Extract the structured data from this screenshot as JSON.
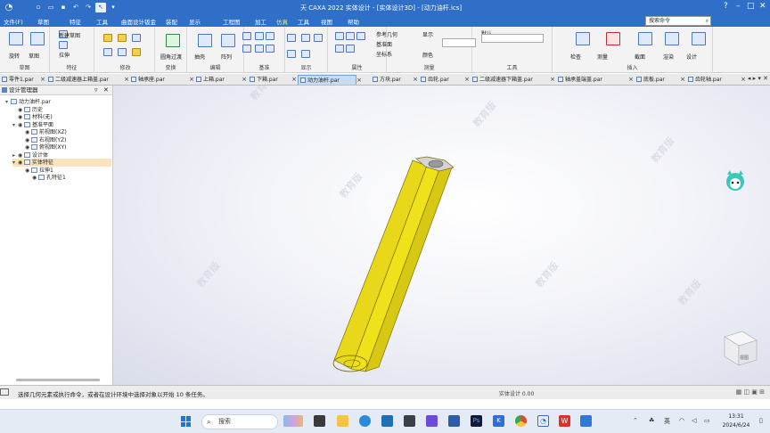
{
  "window": {
    "title": "天 CAXA 2022 实体设计 - [实体设计3D] - [动力油杆.ics]",
    "quick_access": [
      "new",
      "open",
      "save",
      "undo",
      "redo",
      "select"
    ]
  },
  "menu": {
    "items": [
      "文件(F)",
      "草图",
      "特征",
      "工具",
      "曲面设计",
      "钣金",
      "装配",
      "显示",
      "工程图",
      "加工",
      "仿真",
      "工具",
      "视图",
      "帮助"
    ],
    "active_index": 10,
    "search_placeholder": "搜索命令"
  },
  "ribbon": {
    "groups": [
      {
        "label": "草图"
      },
      {
        "label": "特征"
      },
      {
        "label": "修改"
      },
      {
        "label": "变换"
      },
      {
        "label": "编辑"
      },
      {
        "label": "基准"
      },
      {
        "label": "显示"
      },
      {
        "label": "属性"
      },
      {
        "label": "测量"
      },
      {
        "label": "工具"
      },
      {
        "label": "插入"
      }
    ],
    "texts": {
      "sketch_t1": "拉伸",
      "sketch_t2": "旋转",
      "sketch_t3": "新建草图",
      "sketch_t4": "草图",
      "fillet_label": "圆角过渡",
      "shell_label": "抽壳",
      "transform_label": "阵列",
      "ref_t1": "参考几何",
      "ref_t2": "基准面",
      "ref_t3": "坐标系",
      "prop_t1": "显示",
      "prop_t2": "颜色",
      "prop_t3": "默认",
      "tool_t1": "检查",
      "tool_t2": "测量",
      "tool_t3": "截面",
      "tool_t4": "渲染",
      "tool_t5": "设计"
    }
  },
  "doc_tabs": [
    "零件1.par",
    "二级减速器上箱盖.par",
    "轴承座.par",
    "上箱.par",
    "下箱.par",
    "动力油杆.par",
    "方块.par",
    "齿轮.par",
    "二级减速器下箱盖.par",
    "轴承盖端盖.par",
    "底板.par",
    "齿轮轴.par"
  ],
  "active_tab_index": 5,
  "tree": {
    "header": "设计管理器",
    "rows": [
      {
        "label": "动力油杆.par",
        "indent": 0,
        "expander": "▾"
      },
      {
        "label": "历史",
        "indent": 1,
        "expander": ""
      },
      {
        "label": "材料(无)",
        "indent": 1,
        "expander": ""
      },
      {
        "label": "基准平面",
        "indent": 1,
        "expander": "▾"
      },
      {
        "label": "前视图(XZ)",
        "indent": 2,
        "expander": ""
      },
      {
        "label": "右视图(YZ)",
        "indent": 2,
        "expander": ""
      },
      {
        "label": "俯视图(XY)",
        "indent": 2,
        "expander": ""
      },
      {
        "label": "设计体",
        "indent": 1,
        "expander": "▸"
      },
      {
        "label": "实体特征",
        "indent": 1,
        "expander": "▾",
        "highlight": true
      },
      {
        "label": "拉伸1",
        "indent": 2,
        "expander": ""
      },
      {
        "label": "孔特征1",
        "indent": 3,
        "expander": ""
      }
    ]
  },
  "viewport": {
    "watermark": "教育版",
    "part_color": "#f0e21a",
    "part_edge_color": "#7c6f0a",
    "cube_label": "视图"
  },
  "status": {
    "message": "选择几何元素或执行命令，或者在设计环境中选择对象以开始 10 条任务。",
    "mode": "实体设计 0.00"
  },
  "taskbar": {
    "search_placeholder": "搜索",
    "tray_lang": "英",
    "time": "13:31",
    "date": "2024/6/24"
  }
}
